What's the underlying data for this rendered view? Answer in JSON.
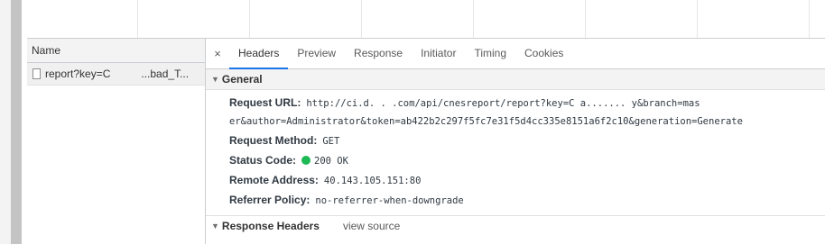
{
  "request_list": {
    "header": "Name",
    "items": [
      {
        "name_start": "report?key=C",
        "name_end": "...bad_T..."
      }
    ]
  },
  "tabs": {
    "close": "×",
    "items": [
      {
        "label": "Headers",
        "active": true
      },
      {
        "label": "Preview"
      },
      {
        "label": "Response"
      },
      {
        "label": "Initiator"
      },
      {
        "label": "Timing"
      },
      {
        "label": "Cookies"
      }
    ]
  },
  "general": {
    "title": "General",
    "request_url_label": "Request URL:",
    "request_url_line1": "http://ci.d.      .   .com/api/cnesreport/report?key=C    a.......       y&branch=mas",
    "request_url_line2": "er&author=Administrator&token=ab422b2c297f5fc7e31f5d4cc335e8151a6f2c10&generation=Generate",
    "request_method_label": "Request Method:",
    "request_method": "GET",
    "status_code_label": "Status Code:",
    "status_code": "200 OK",
    "status_color": "#1db954",
    "remote_address_label": "Remote Address:",
    "remote_address": "40.143.105.151:80",
    "referrer_policy_label": "Referrer Policy:",
    "referrer_policy": "no-referrer-when-downgrade"
  },
  "response_headers": {
    "title": "Response Headers",
    "view_source": "view source"
  }
}
